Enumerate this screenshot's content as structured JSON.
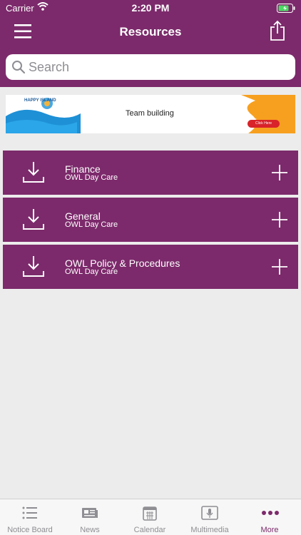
{
  "status_bar": {
    "carrier": "Carrier",
    "time": "2:20 PM"
  },
  "header": {
    "title": "Resources"
  },
  "search": {
    "placeholder": "Search"
  },
  "banner": {
    "text": "Team building",
    "logo_text": "HAPPY ISLAND",
    "cta": "Click Here"
  },
  "resources": [
    {
      "title": "Finance",
      "subtitle": "OWL Day Care"
    },
    {
      "title": "General",
      "subtitle": "OWL Day Care"
    },
    {
      "title": "OWL Policy & Procedures",
      "subtitle": "OWL Day Care"
    }
  ],
  "tabs": [
    {
      "label": "Notice Board",
      "icon": "list-icon"
    },
    {
      "label": "News",
      "icon": "newspaper-icon"
    },
    {
      "label": "Calendar",
      "icon": "calendar-icon"
    },
    {
      "label": "Multimedia",
      "icon": "microphone-icon"
    },
    {
      "label": "More",
      "icon": "more-dots-icon",
      "active": true
    }
  ],
  "colors": {
    "brand": "#7c2a6b",
    "background": "#ececec",
    "tab_inactive": "#8e8e93"
  }
}
